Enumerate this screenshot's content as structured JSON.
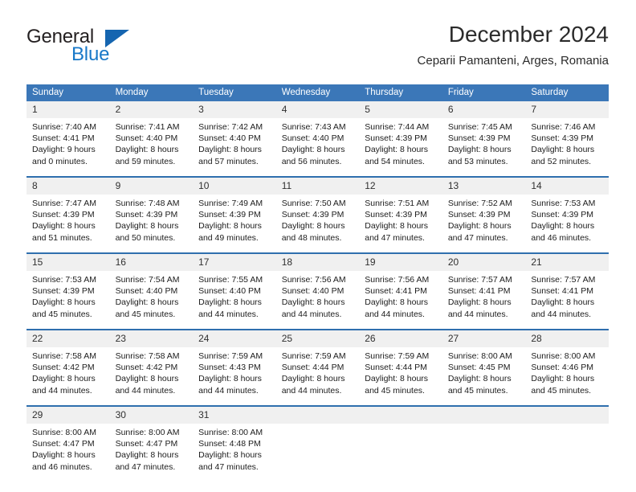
{
  "brand": {
    "name_part1": "General",
    "name_part2": "Blue",
    "accent_color": "#1878c8",
    "triangle_color": "#1565b0"
  },
  "header": {
    "month_title": "December 2024",
    "location": "Ceparii Pamanteni, Arges, Romania"
  },
  "theme": {
    "header_bg": "#3b77b8",
    "row_border": "#2f6fae",
    "daynum_bg": "#f0f0f0"
  },
  "calendar": {
    "weekday_headers": [
      "Sunday",
      "Monday",
      "Tuesday",
      "Wednesday",
      "Thursday",
      "Friday",
      "Saturday"
    ],
    "weeks": [
      [
        {
          "day": "1",
          "sunrise": "Sunrise: 7:40 AM",
          "sunset": "Sunset: 4:41 PM",
          "daylight_line1": "Daylight: 9 hours",
          "daylight_line2": "and 0 minutes."
        },
        {
          "day": "2",
          "sunrise": "Sunrise: 7:41 AM",
          "sunset": "Sunset: 4:40 PM",
          "daylight_line1": "Daylight: 8 hours",
          "daylight_line2": "and 59 minutes."
        },
        {
          "day": "3",
          "sunrise": "Sunrise: 7:42 AM",
          "sunset": "Sunset: 4:40 PM",
          "daylight_line1": "Daylight: 8 hours",
          "daylight_line2": "and 57 minutes."
        },
        {
          "day": "4",
          "sunrise": "Sunrise: 7:43 AM",
          "sunset": "Sunset: 4:40 PM",
          "daylight_line1": "Daylight: 8 hours",
          "daylight_line2": "and 56 minutes."
        },
        {
          "day": "5",
          "sunrise": "Sunrise: 7:44 AM",
          "sunset": "Sunset: 4:39 PM",
          "daylight_line1": "Daylight: 8 hours",
          "daylight_line2": "and 54 minutes."
        },
        {
          "day": "6",
          "sunrise": "Sunrise: 7:45 AM",
          "sunset": "Sunset: 4:39 PM",
          "daylight_line1": "Daylight: 8 hours",
          "daylight_line2": "and 53 minutes."
        },
        {
          "day": "7",
          "sunrise": "Sunrise: 7:46 AM",
          "sunset": "Sunset: 4:39 PM",
          "daylight_line1": "Daylight: 8 hours",
          "daylight_line2": "and 52 minutes."
        }
      ],
      [
        {
          "day": "8",
          "sunrise": "Sunrise: 7:47 AM",
          "sunset": "Sunset: 4:39 PM",
          "daylight_line1": "Daylight: 8 hours",
          "daylight_line2": "and 51 minutes."
        },
        {
          "day": "9",
          "sunrise": "Sunrise: 7:48 AM",
          "sunset": "Sunset: 4:39 PM",
          "daylight_line1": "Daylight: 8 hours",
          "daylight_line2": "and 50 minutes."
        },
        {
          "day": "10",
          "sunrise": "Sunrise: 7:49 AM",
          "sunset": "Sunset: 4:39 PM",
          "daylight_line1": "Daylight: 8 hours",
          "daylight_line2": "and 49 minutes."
        },
        {
          "day": "11",
          "sunrise": "Sunrise: 7:50 AM",
          "sunset": "Sunset: 4:39 PM",
          "daylight_line1": "Daylight: 8 hours",
          "daylight_line2": "and 48 minutes."
        },
        {
          "day": "12",
          "sunrise": "Sunrise: 7:51 AM",
          "sunset": "Sunset: 4:39 PM",
          "daylight_line1": "Daylight: 8 hours",
          "daylight_line2": "and 47 minutes."
        },
        {
          "day": "13",
          "sunrise": "Sunrise: 7:52 AM",
          "sunset": "Sunset: 4:39 PM",
          "daylight_line1": "Daylight: 8 hours",
          "daylight_line2": "and 47 minutes."
        },
        {
          "day": "14",
          "sunrise": "Sunrise: 7:53 AM",
          "sunset": "Sunset: 4:39 PM",
          "daylight_line1": "Daylight: 8 hours",
          "daylight_line2": "and 46 minutes."
        }
      ],
      [
        {
          "day": "15",
          "sunrise": "Sunrise: 7:53 AM",
          "sunset": "Sunset: 4:39 PM",
          "daylight_line1": "Daylight: 8 hours",
          "daylight_line2": "and 45 minutes."
        },
        {
          "day": "16",
          "sunrise": "Sunrise: 7:54 AM",
          "sunset": "Sunset: 4:40 PM",
          "daylight_line1": "Daylight: 8 hours",
          "daylight_line2": "and 45 minutes."
        },
        {
          "day": "17",
          "sunrise": "Sunrise: 7:55 AM",
          "sunset": "Sunset: 4:40 PM",
          "daylight_line1": "Daylight: 8 hours",
          "daylight_line2": "and 44 minutes."
        },
        {
          "day": "18",
          "sunrise": "Sunrise: 7:56 AM",
          "sunset": "Sunset: 4:40 PM",
          "daylight_line1": "Daylight: 8 hours",
          "daylight_line2": "and 44 minutes."
        },
        {
          "day": "19",
          "sunrise": "Sunrise: 7:56 AM",
          "sunset": "Sunset: 4:41 PM",
          "daylight_line1": "Daylight: 8 hours",
          "daylight_line2": "and 44 minutes."
        },
        {
          "day": "20",
          "sunrise": "Sunrise: 7:57 AM",
          "sunset": "Sunset: 4:41 PM",
          "daylight_line1": "Daylight: 8 hours",
          "daylight_line2": "and 44 minutes."
        },
        {
          "day": "21",
          "sunrise": "Sunrise: 7:57 AM",
          "sunset": "Sunset: 4:41 PM",
          "daylight_line1": "Daylight: 8 hours",
          "daylight_line2": "and 44 minutes."
        }
      ],
      [
        {
          "day": "22",
          "sunrise": "Sunrise: 7:58 AM",
          "sunset": "Sunset: 4:42 PM",
          "daylight_line1": "Daylight: 8 hours",
          "daylight_line2": "and 44 minutes."
        },
        {
          "day": "23",
          "sunrise": "Sunrise: 7:58 AM",
          "sunset": "Sunset: 4:42 PM",
          "daylight_line1": "Daylight: 8 hours",
          "daylight_line2": "and 44 minutes."
        },
        {
          "day": "24",
          "sunrise": "Sunrise: 7:59 AM",
          "sunset": "Sunset: 4:43 PM",
          "daylight_line1": "Daylight: 8 hours",
          "daylight_line2": "and 44 minutes."
        },
        {
          "day": "25",
          "sunrise": "Sunrise: 7:59 AM",
          "sunset": "Sunset: 4:44 PM",
          "daylight_line1": "Daylight: 8 hours",
          "daylight_line2": "and 44 minutes."
        },
        {
          "day": "26",
          "sunrise": "Sunrise: 7:59 AM",
          "sunset": "Sunset: 4:44 PM",
          "daylight_line1": "Daylight: 8 hours",
          "daylight_line2": "and 45 minutes."
        },
        {
          "day": "27",
          "sunrise": "Sunrise: 8:00 AM",
          "sunset": "Sunset: 4:45 PM",
          "daylight_line1": "Daylight: 8 hours",
          "daylight_line2": "and 45 minutes."
        },
        {
          "day": "28",
          "sunrise": "Sunrise: 8:00 AM",
          "sunset": "Sunset: 4:46 PM",
          "daylight_line1": "Daylight: 8 hours",
          "daylight_line2": "and 45 minutes."
        }
      ],
      [
        {
          "day": "29",
          "sunrise": "Sunrise: 8:00 AM",
          "sunset": "Sunset: 4:47 PM",
          "daylight_line1": "Daylight: 8 hours",
          "daylight_line2": "and 46 minutes."
        },
        {
          "day": "30",
          "sunrise": "Sunrise: 8:00 AM",
          "sunset": "Sunset: 4:47 PM",
          "daylight_line1": "Daylight: 8 hours",
          "daylight_line2": "and 47 minutes."
        },
        {
          "day": "31",
          "sunrise": "Sunrise: 8:00 AM",
          "sunset": "Sunset: 4:48 PM",
          "daylight_line1": "Daylight: 8 hours",
          "daylight_line2": "and 47 minutes."
        },
        {
          "day": "",
          "sunrise": "",
          "sunset": "",
          "daylight_line1": "",
          "daylight_line2": ""
        },
        {
          "day": "",
          "sunrise": "",
          "sunset": "",
          "daylight_line1": "",
          "daylight_line2": ""
        },
        {
          "day": "",
          "sunrise": "",
          "sunset": "",
          "daylight_line1": "",
          "daylight_line2": ""
        },
        {
          "day": "",
          "sunrise": "",
          "sunset": "",
          "daylight_line1": "",
          "daylight_line2": ""
        }
      ]
    ]
  }
}
